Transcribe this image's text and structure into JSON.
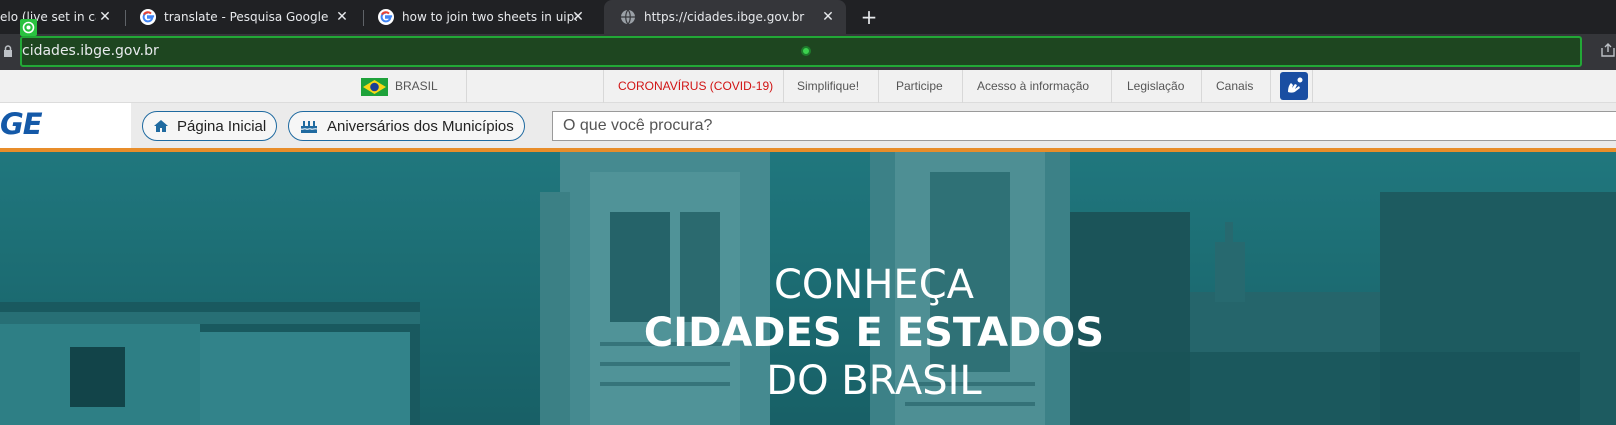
{
  "browser": {
    "tabs": [
      {
        "title": "elo (live set in castl",
        "favicon": "green-circle-icon"
      },
      {
        "title": "translate - Pesquisa Google",
        "favicon": "google-icon"
      },
      {
        "title": "how to join two sheets in uipath",
        "favicon": "google-icon"
      },
      {
        "title": "https://cidades.ibge.gov.br",
        "favicon": "globe-icon",
        "active": true
      }
    ],
    "new_tab": "+",
    "close_glyph": "✕",
    "address": "cidades.ibge.gov.br"
  },
  "gov_bar": {
    "country": "BRASIL",
    "links": [
      "CORONAVÍRUS (COVID-19)",
      "Simplifique!",
      "Participe",
      "Acesso à informação",
      "Legislação",
      "Canais"
    ]
  },
  "header": {
    "logo": "GE",
    "home_button": "Página Inicial",
    "anniversaries_button": "Aniversários dos Municípios",
    "search_placeholder": "O que você procura?"
  },
  "hero": {
    "line1": "CONHEÇA",
    "line2": "CIDADES E ESTADOS",
    "line3": "DO BRASIL"
  },
  "colors": {
    "brand_blue": "#1459a8",
    "accent_orange": "#e88d2a",
    "covid_red": "#d11414",
    "hero_teal": "#1e6f76"
  }
}
